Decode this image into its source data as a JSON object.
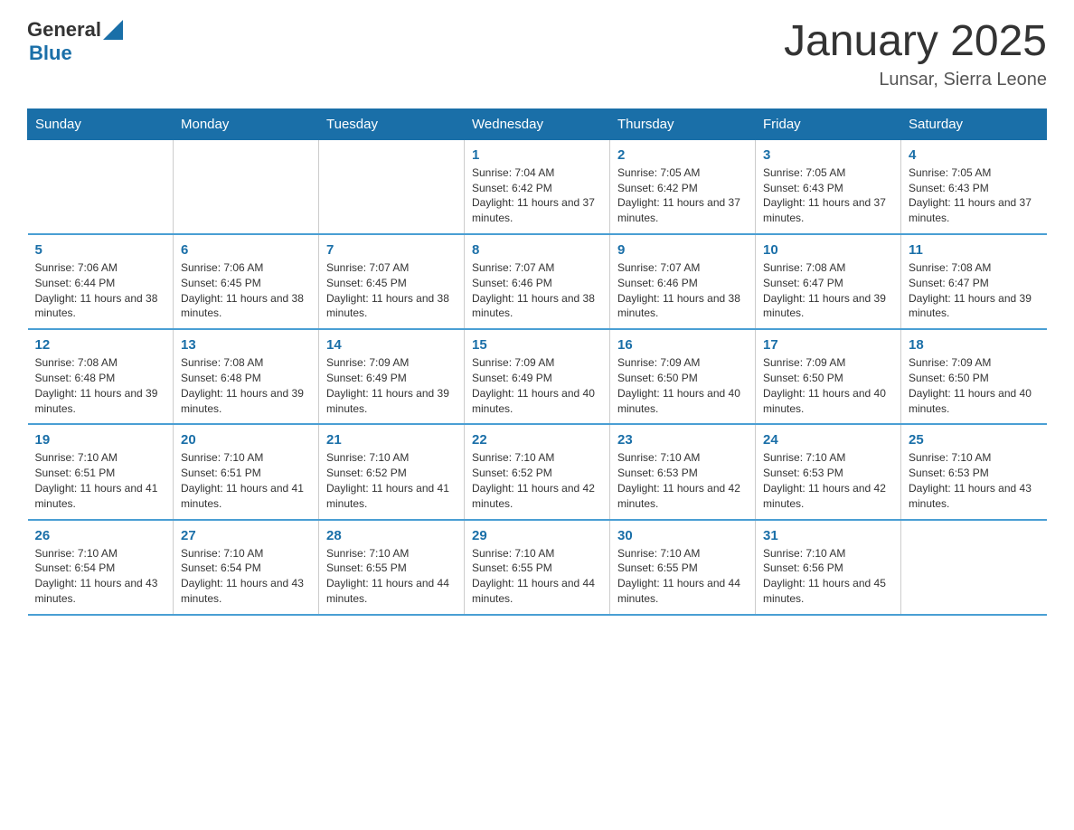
{
  "header": {
    "logo": {
      "line1": "General",
      "line2": "Blue",
      "icon": "▶"
    },
    "title": "January 2025",
    "subtitle": "Lunsar, Sierra Leone"
  },
  "weekdays": [
    "Sunday",
    "Monday",
    "Tuesday",
    "Wednesday",
    "Thursday",
    "Friday",
    "Saturday"
  ],
  "weeks": [
    [
      {
        "day": "",
        "info": ""
      },
      {
        "day": "",
        "info": ""
      },
      {
        "day": "",
        "info": ""
      },
      {
        "day": "1",
        "info": "Sunrise: 7:04 AM\nSunset: 6:42 PM\nDaylight: 11 hours and 37 minutes."
      },
      {
        "day": "2",
        "info": "Sunrise: 7:05 AM\nSunset: 6:42 PM\nDaylight: 11 hours and 37 minutes."
      },
      {
        "day": "3",
        "info": "Sunrise: 7:05 AM\nSunset: 6:43 PM\nDaylight: 11 hours and 37 minutes."
      },
      {
        "day": "4",
        "info": "Sunrise: 7:05 AM\nSunset: 6:43 PM\nDaylight: 11 hours and 37 minutes."
      }
    ],
    [
      {
        "day": "5",
        "info": "Sunrise: 7:06 AM\nSunset: 6:44 PM\nDaylight: 11 hours and 38 minutes."
      },
      {
        "day": "6",
        "info": "Sunrise: 7:06 AM\nSunset: 6:45 PM\nDaylight: 11 hours and 38 minutes."
      },
      {
        "day": "7",
        "info": "Sunrise: 7:07 AM\nSunset: 6:45 PM\nDaylight: 11 hours and 38 minutes."
      },
      {
        "day": "8",
        "info": "Sunrise: 7:07 AM\nSunset: 6:46 PM\nDaylight: 11 hours and 38 minutes."
      },
      {
        "day": "9",
        "info": "Sunrise: 7:07 AM\nSunset: 6:46 PM\nDaylight: 11 hours and 38 minutes."
      },
      {
        "day": "10",
        "info": "Sunrise: 7:08 AM\nSunset: 6:47 PM\nDaylight: 11 hours and 39 minutes."
      },
      {
        "day": "11",
        "info": "Sunrise: 7:08 AM\nSunset: 6:47 PM\nDaylight: 11 hours and 39 minutes."
      }
    ],
    [
      {
        "day": "12",
        "info": "Sunrise: 7:08 AM\nSunset: 6:48 PM\nDaylight: 11 hours and 39 minutes."
      },
      {
        "day": "13",
        "info": "Sunrise: 7:08 AM\nSunset: 6:48 PM\nDaylight: 11 hours and 39 minutes."
      },
      {
        "day": "14",
        "info": "Sunrise: 7:09 AM\nSunset: 6:49 PM\nDaylight: 11 hours and 39 minutes."
      },
      {
        "day": "15",
        "info": "Sunrise: 7:09 AM\nSunset: 6:49 PM\nDaylight: 11 hours and 40 minutes."
      },
      {
        "day": "16",
        "info": "Sunrise: 7:09 AM\nSunset: 6:50 PM\nDaylight: 11 hours and 40 minutes."
      },
      {
        "day": "17",
        "info": "Sunrise: 7:09 AM\nSunset: 6:50 PM\nDaylight: 11 hours and 40 minutes."
      },
      {
        "day": "18",
        "info": "Sunrise: 7:09 AM\nSunset: 6:50 PM\nDaylight: 11 hours and 40 minutes."
      }
    ],
    [
      {
        "day": "19",
        "info": "Sunrise: 7:10 AM\nSunset: 6:51 PM\nDaylight: 11 hours and 41 minutes."
      },
      {
        "day": "20",
        "info": "Sunrise: 7:10 AM\nSunset: 6:51 PM\nDaylight: 11 hours and 41 minutes."
      },
      {
        "day": "21",
        "info": "Sunrise: 7:10 AM\nSunset: 6:52 PM\nDaylight: 11 hours and 41 minutes."
      },
      {
        "day": "22",
        "info": "Sunrise: 7:10 AM\nSunset: 6:52 PM\nDaylight: 11 hours and 42 minutes."
      },
      {
        "day": "23",
        "info": "Sunrise: 7:10 AM\nSunset: 6:53 PM\nDaylight: 11 hours and 42 minutes."
      },
      {
        "day": "24",
        "info": "Sunrise: 7:10 AM\nSunset: 6:53 PM\nDaylight: 11 hours and 42 minutes."
      },
      {
        "day": "25",
        "info": "Sunrise: 7:10 AM\nSunset: 6:53 PM\nDaylight: 11 hours and 43 minutes."
      }
    ],
    [
      {
        "day": "26",
        "info": "Sunrise: 7:10 AM\nSunset: 6:54 PM\nDaylight: 11 hours and 43 minutes."
      },
      {
        "day": "27",
        "info": "Sunrise: 7:10 AM\nSunset: 6:54 PM\nDaylight: 11 hours and 43 minutes."
      },
      {
        "day": "28",
        "info": "Sunrise: 7:10 AM\nSunset: 6:55 PM\nDaylight: 11 hours and 44 minutes."
      },
      {
        "day": "29",
        "info": "Sunrise: 7:10 AM\nSunset: 6:55 PM\nDaylight: 11 hours and 44 minutes."
      },
      {
        "day": "30",
        "info": "Sunrise: 7:10 AM\nSunset: 6:55 PM\nDaylight: 11 hours and 44 minutes."
      },
      {
        "day": "31",
        "info": "Sunrise: 7:10 AM\nSunset: 6:56 PM\nDaylight: 11 hours and 45 minutes."
      },
      {
        "day": "",
        "info": ""
      }
    ]
  ]
}
